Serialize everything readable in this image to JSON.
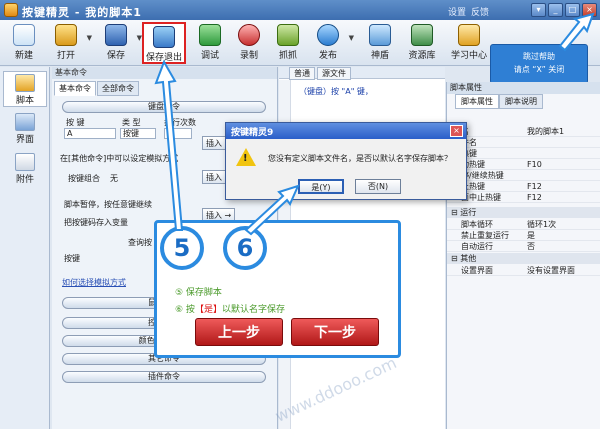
{
  "window": {
    "title": "按键精灵 - 我的脚本1",
    "links": [
      "设置",
      "反馈"
    ]
  },
  "toolbar": {
    "items": [
      {
        "label": "新建",
        "icon": "new-file-icon"
      },
      {
        "label": "打开",
        "icon": "open-folder-icon"
      },
      {
        "label": "保存",
        "icon": "save-icon"
      },
      {
        "label": "保存退出",
        "icon": "save-exit-icon"
      },
      {
        "label": "调试",
        "icon": "debug-icon"
      },
      {
        "label": "录制",
        "icon": "record-icon"
      },
      {
        "label": "抓抓",
        "icon": "grab-icon"
      },
      {
        "label": "发布",
        "icon": "publish-icon"
      },
      {
        "label": "神盾",
        "icon": "shield-icon"
      },
      {
        "label": "资源库",
        "icon": "resource-icon"
      },
      {
        "label": "学习中心",
        "icon": "learn-icon"
      }
    ]
  },
  "help_tip": {
    "line1": "跳过帮助",
    "line2": "请点 “X” 关闭"
  },
  "leftnav": {
    "items": [
      "脚本",
      "界面",
      "附件"
    ]
  },
  "panel": {
    "header": "基本命令",
    "tabs": [
      "基本命令",
      "全部命令"
    ],
    "keyboard_group": "键盘命令",
    "col_key": "按 键",
    "col_type": "类 型",
    "col_count": "执行次数",
    "key_value": "A",
    "type_value": "按键",
    "count_value": "1",
    "insert": "插入",
    "text_other_cmd": "在[其他命令]中可以设定模拟方式",
    "combo_label": "按键组合",
    "combo_value": "无",
    "pause_text": "脚本暂停，按任意键继续",
    "store_text": "把按键码存入变量",
    "insert_arrow": "插入 →",
    "query_label": "查询按",
    "key_label": "按键",
    "sim_link": "如何选择模拟方式",
    "groups": [
      "鼠标命令",
      "控制命令",
      "颜色/图形命令",
      "其它命令",
      "插件命令"
    ]
  },
  "editor": {
    "tabs": [
      "普通",
      "源文件"
    ],
    "code_line": "（键盘）按 \"A\" 键，"
  },
  "props": {
    "title": "脚本属性",
    "tabs": [
      "脚本属性",
      "脚本说明"
    ],
    "rows": [
      {
        "k": "名",
        "v": "我的脚本1"
      },
      {
        "k": "件名",
        "v": ""
      },
      {
        "k": "热键",
        "v": ""
      },
      {
        "k": "动热键",
        "v": "F10"
      },
      {
        "k": "停/继续热键",
        "v": ""
      },
      {
        "k": "止热键",
        "v": "F12"
      },
      {
        "k": "面中止热键",
        "v": "F12"
      }
    ],
    "cat_run": "运行",
    "run_rows": [
      {
        "k": "脚本循环",
        "v": "循环1次"
      },
      {
        "k": "禁止重复运行",
        "v": "是"
      },
      {
        "k": "自动运行",
        "v": "否"
      }
    ],
    "cat_other": "其他",
    "other_rows": [
      {
        "k": "设置界面",
        "v": "没有设置界面"
      }
    ]
  },
  "dialog": {
    "title": "按键精灵9",
    "message": "您没有定义脚本文件名，是否以默认名字保存脚本？",
    "yes": "是(Y)",
    "no": "否(N)"
  },
  "tutorial": {
    "step5_num": "5",
    "step6_num": "6",
    "step5_text": "⑤ 保存脚本",
    "step6_prefix": "⑥ 按",
    "step6_hl": "【是】",
    "step6_suffix": "以默认名字保存",
    "prev": "上一步",
    "next": "下一步"
  },
  "colors": {
    "accent": "#2b8be0",
    "button_red": "#c62828",
    "tip_blue": "#2f7fd4"
  }
}
